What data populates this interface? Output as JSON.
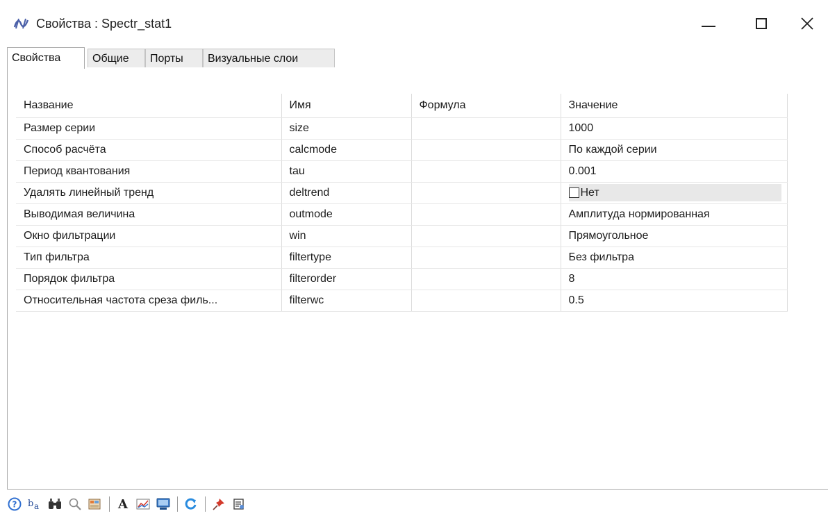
{
  "window": {
    "title": "Свойства : Spectr_stat1",
    "minimize_icon": "minimize-icon",
    "maximize_icon": "maximize-icon",
    "close_icon": "close-icon"
  },
  "tabs": [
    {
      "label": "Свойства",
      "active": true
    },
    {
      "label": "Общие",
      "active": false
    },
    {
      "label": "Порты",
      "active": false
    },
    {
      "label": "Визуальные слои",
      "active": false
    }
  ],
  "table": {
    "headers": [
      "Название",
      "Имя",
      "Формула",
      "Значение"
    ],
    "rows": [
      {
        "name": "Размер серии",
        "id": "size",
        "formula": "",
        "value": "1000"
      },
      {
        "name": "Способ расчёта",
        "id": "calcmode",
        "formula": "",
        "value": "По каждой серии"
      },
      {
        "name": "Период квантования",
        "id": "tau",
        "formula": "",
        "value": "0.001"
      },
      {
        "name": "Удалять линейный тренд",
        "id": "deltrend",
        "formula": "",
        "value": "Нет",
        "checkbox": true,
        "checked": false
      },
      {
        "name": "Выводимая величина",
        "id": "outmode",
        "formula": "",
        "value": "Амплитуда нормированная"
      },
      {
        "name": "Окно фильтрации",
        "id": "win",
        "formula": "",
        "value": "Прямоугольное"
      },
      {
        "name": "Тип фильтра",
        "id": "filtertype",
        "formula": "",
        "value": "Без фильтра"
      },
      {
        "name": "Порядок фильтра",
        "id": "filterorder",
        "formula": "",
        "value": "8"
      },
      {
        "name": "Относительная частота среза филь...",
        "id": "filterwc",
        "formula": "",
        "value": "0.5"
      }
    ]
  },
  "toolbar": {
    "items": [
      "help-icon",
      "sort-alpha-icon",
      "binoculars-icon",
      "zoom-icon",
      "palette-icon",
      "font-icon",
      "chart-icon",
      "monitor-icon",
      "refresh-icon",
      "pin-icon",
      "properties-icon"
    ],
    "font_glyph": "A"
  },
  "colors": {
    "help": "#2f6fd1",
    "binoculars": "#333333",
    "refresh": "#2a8cdf",
    "pin": "#d33a2c"
  }
}
